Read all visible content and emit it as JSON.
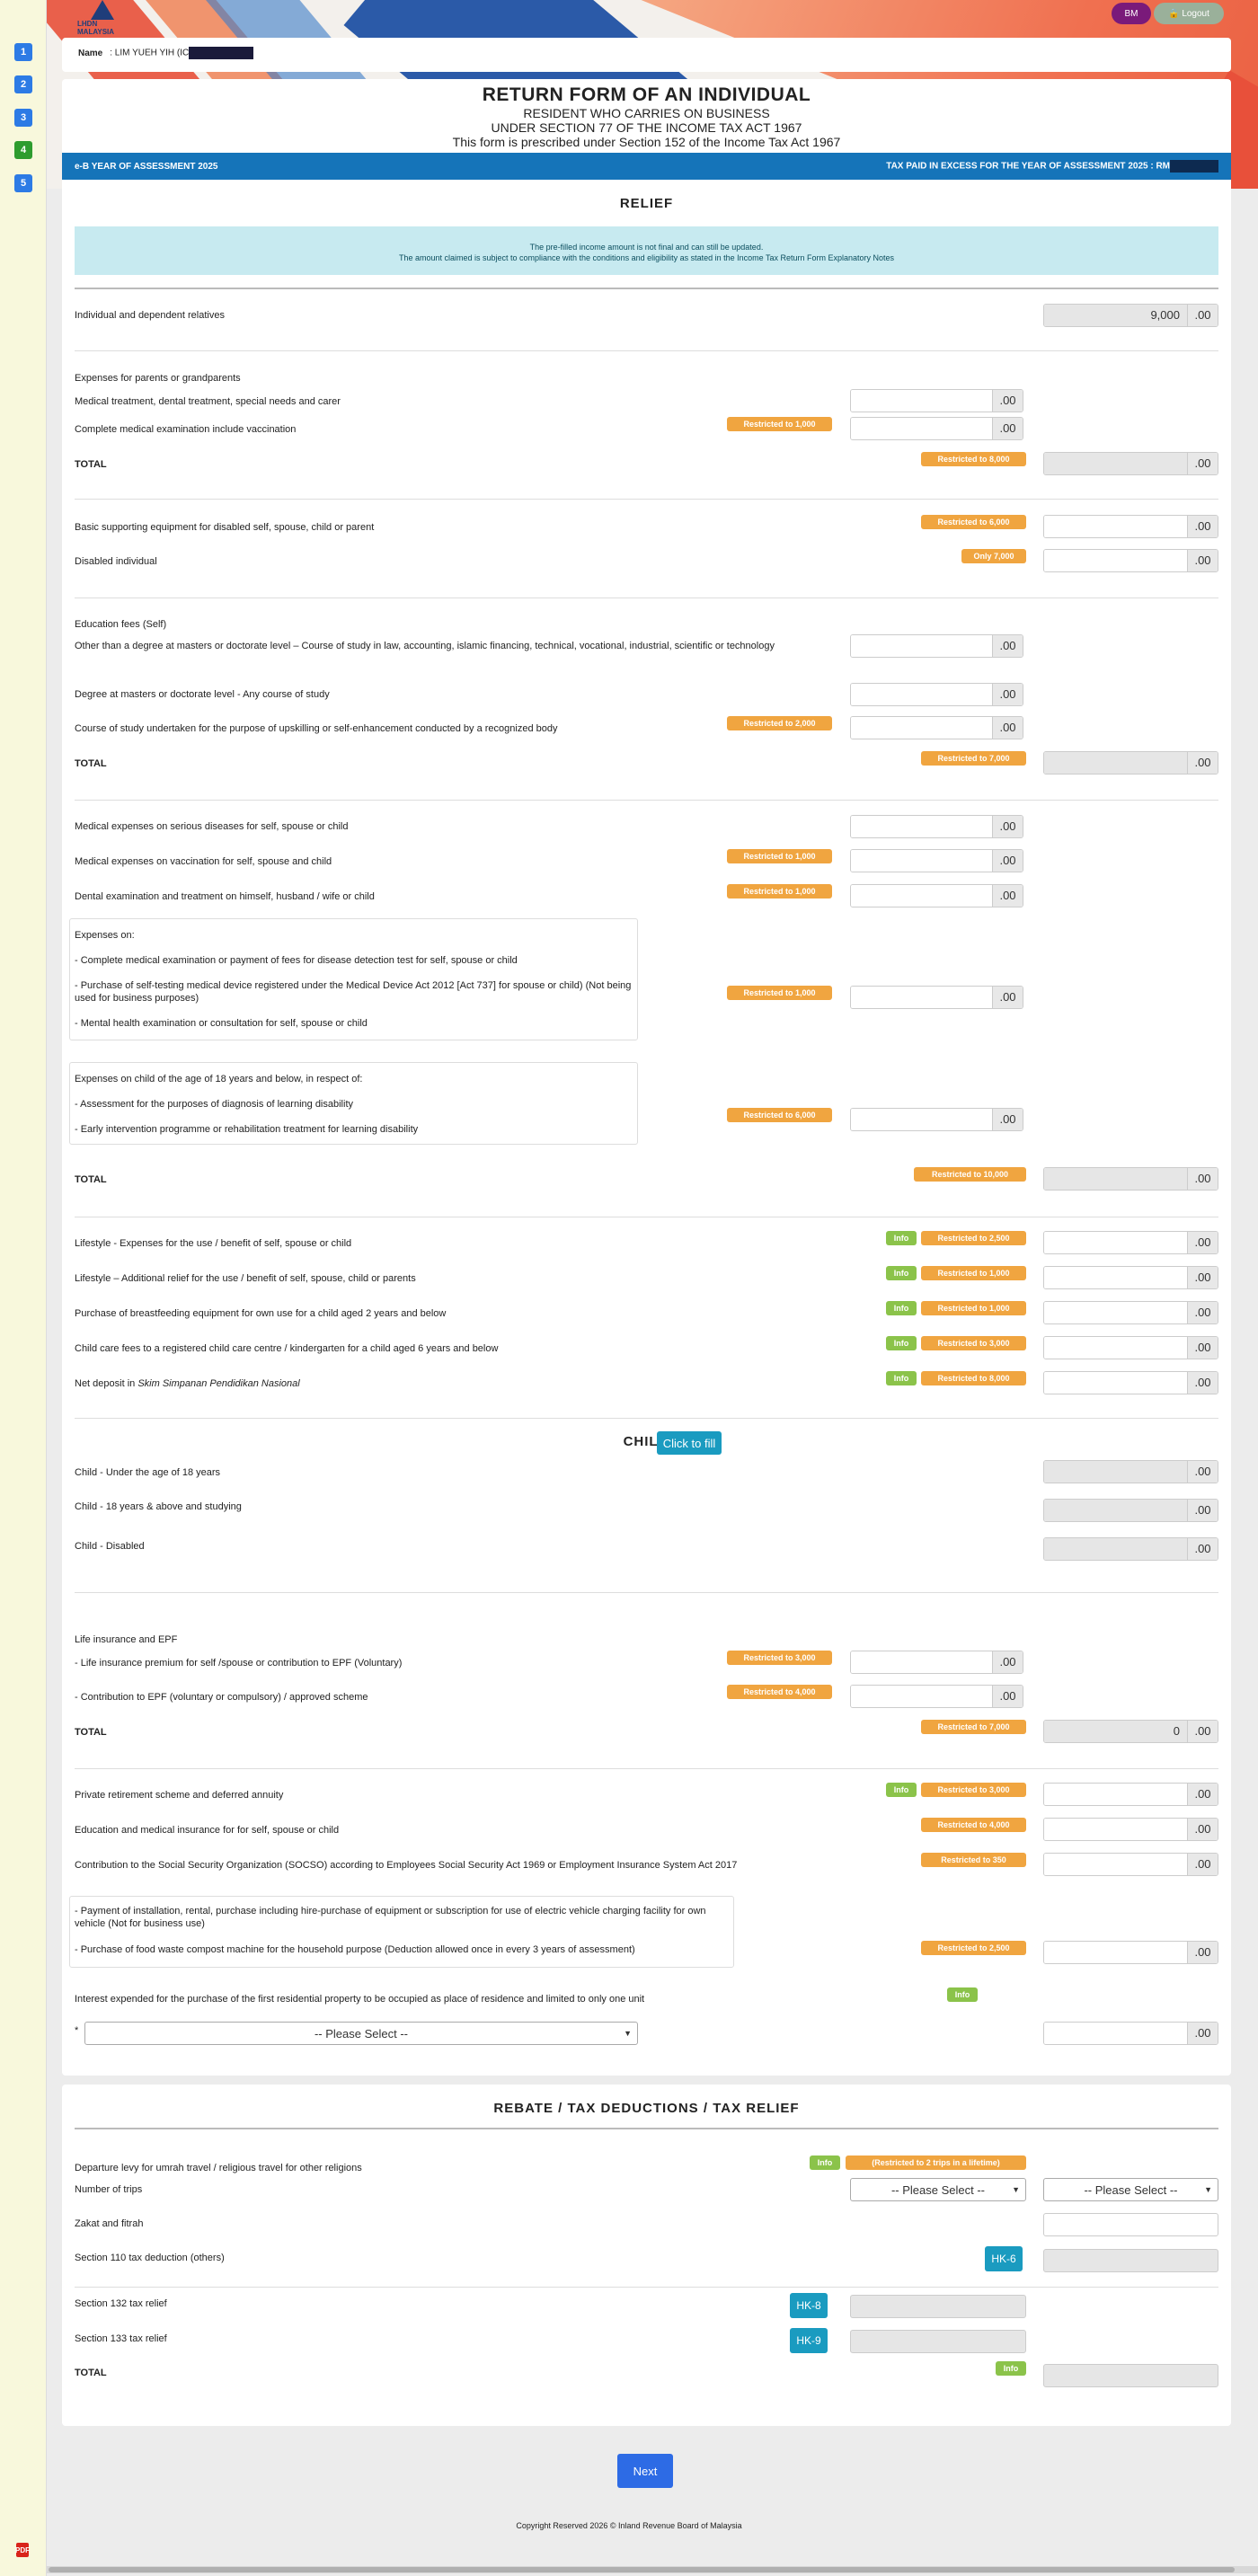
{
  "header": {
    "logo_text": "LHDN MALAYSIA",
    "bm_label": "BM",
    "logout_label": "Logout",
    "logout_icon": "lock-icon"
  },
  "sidebar": {
    "steps": [
      "1",
      "2",
      "3",
      "4",
      "5"
    ],
    "active_step": "4",
    "pdf_icon": "pdf-icon"
  },
  "taxpayer": {
    "name_label": "Name",
    "name_value": ": LIM YUEH YIH (IC"
  },
  "form": {
    "title": "RETURN FORM OF AN INDIVIDUAL",
    "line1": "RESIDENT WHO CARRIES ON BUSINESS",
    "line2": "UNDER SECTION 77 OF THE INCOME TAX ACT 1967",
    "line3": "This form is prescribed under Section 152 of the Income Tax Act 1967"
  },
  "bluebar": {
    "left": "e-B YEAR OF ASSESSMENT 2025",
    "right": "TAX PAID IN EXCESS FOR THE YEAR OF ASSESSMENT 2025 : RM"
  },
  "relief": {
    "title": "RELIEF",
    "notice1": "The pre-filled income amount is not final and can still be updated.",
    "notice2": "The amount claimed is subject to compliance with the conditions and eligibility as stated in the Income Tax Return Form Explanatory Notes",
    "individual": "Individual and dependent relatives",
    "individual_value": "9,000",
    "dec": ".00",
    "parents_head": "Expenses for parents or grandparents",
    "parents_medical": "Medical treatment, dental treatment, special needs and carer",
    "parents_exam": "Complete medical examination include vaccination",
    "parents_exam_badge": "Restricted to 1,000",
    "total": "TOTAL",
    "parents_total_badge": "Restricted to 8,000",
    "basic_equipment": "Basic supporting equipment for disabled self, spouse, child or parent",
    "basic_equipment_badge": "Restricted to 6,000",
    "disabled": "Disabled individual",
    "disabled_badge": "Only 7,000",
    "edu_head": "Education fees (Self)",
    "edu_other": "Other than a degree at masters or doctorate level – Course of study in law, accounting, islamic financing, technical, vocational, industrial, scientific or technology",
    "edu_masters": "Degree at masters or doctorate level - Any course of study",
    "edu_upskill": "Course of study undertaken for the purpose of upskilling or self-enhancement conducted by a recognized body",
    "edu_upskill_badge": "Restricted to 2,000",
    "edu_total_badge": "Restricted to 7,000",
    "med_serious": "Medical expenses on serious diseases for self, spouse or child",
    "med_vaccination": "Medical expenses on vaccination for self, spouse and child",
    "med_vaccination_badge": "Restricted to 1,000",
    "dental": "Dental examination and treatment on himself, husband / wife or child",
    "dental_badge": "Restricted to 1,000",
    "exp_on": "Expenses on:",
    "exp_a": "- Complete medical examination or payment of fees for disease detection test for self, spouse or child",
    "exp_b": "- Purchase of self-testing medical device registered under the Medical Device Act 2012 [Act 737] for spouse or child) (Not being used for business purposes)",
    "exp_c": "- Mental health examination or consultation for self, spouse or child",
    "exp_badge": "Restricted to 1,000",
    "child18_head": "Expenses on child of the age of 18 years and below, in respect of:",
    "child18_a": "- Assessment for the purposes of diagnosis of learning disability",
    "child18_b": "- Early intervention programme or rehabilitation treatment for learning disability",
    "child18_badge": "Restricted to 6,000",
    "med_total_badge": "Restricted to 10,000",
    "info": "Info",
    "lifestyle1": "Lifestyle - Expenses for the use / benefit of self, spouse or child",
    "lifestyle1_badge": "Restricted to 2,500",
    "lifestyle2": "Lifestyle – Additional relief for the use / benefit of self, spouse, child or parents",
    "lifestyle2_badge": "Restricted to 1,000",
    "breastfeed": "Purchase of breastfeeding equipment for own use for a child aged 2 years and below",
    "breastfeed_badge": "Restricted to 1,000",
    "childcare": "Child care fees to a registered child care centre / kindergarten for a child aged 6 years and below",
    "childcare_badge": "Restricted to 3,000",
    "sspn_prefix": "Net deposit in ",
    "sspn_name": "Skim Simpanan Pendidikan Nasional",
    "sspn_badge": "Restricted to 8,000",
    "child_title": "CHILD",
    "click_fill": "Click to fill",
    "child_u18": "Child - Under the age of 18 years",
    "child_18study": "Child - 18 years & above and studying",
    "child_disabled": "Child - Disabled",
    "life_head": "Life insurance and EPF",
    "life_premium": "- Life insurance premium for self /spouse or contribution to EPF (Voluntary)",
    "life_premium_badge": "Restricted to 3,000",
    "epf": "- Contribution to EPF (voluntary or compulsory) / approved scheme",
    "epf_badge": "Restricted to 4,000",
    "life_total_badge": "Restricted to 7,000",
    "life_total_value": "0",
    "prs": "Private retirement scheme and deferred annuity",
    "prs_badge": "Restricted to 3,000",
    "edu_med_ins": "Education and medical insurance for for self, spouse or child",
    "edu_med_ins_badge": "Restricted to 4,000",
    "socso": "Contribution to the Social Security Organization (SOCSO) according to Employees Social Security Act 1969 or Employment Insurance System Act 2017",
    "socso_badge": "Restricted to 350",
    "ev": "- Payment of installation, rental, purchase including hire-purchase of equipment or subscription for use of electric vehicle charging facility for own vehicle (Not for business use)",
    "compost": "- Purchase of food waste compost machine for the household purpose (Deduction allowed once in every 3 years of assessment)",
    "ev_badge": "Restricted to 2,500",
    "housing": "Interest expended for the purchase of the first residential property to be occupied as place of residence and limited to only one unit",
    "housing_star": "*",
    "please_select": "-- Please Select --"
  },
  "rebate": {
    "title": "REBATE / TAX DEDUCTIONS / TAX RELIEF",
    "departure": "Departure levy for umrah travel / religious travel for other religions",
    "departure_badge": "(Restricted to 2 trips in a lifetime)",
    "trips": "Number of trips",
    "please_select": "-- Please Select --",
    "zakat": "Zakat and fitrah",
    "s110": "Section 110 tax deduction (others)",
    "hk6": "HK-6",
    "s132": "Section 132 tax relief",
    "hk8": "HK-8",
    "s133": "Section 133 tax relief",
    "hk9": "HK-9",
    "total": "TOTAL"
  },
  "next_label": "Next",
  "footer": "Copyright Reserved 2026 © Inland Revenue Board of Malaysia"
}
